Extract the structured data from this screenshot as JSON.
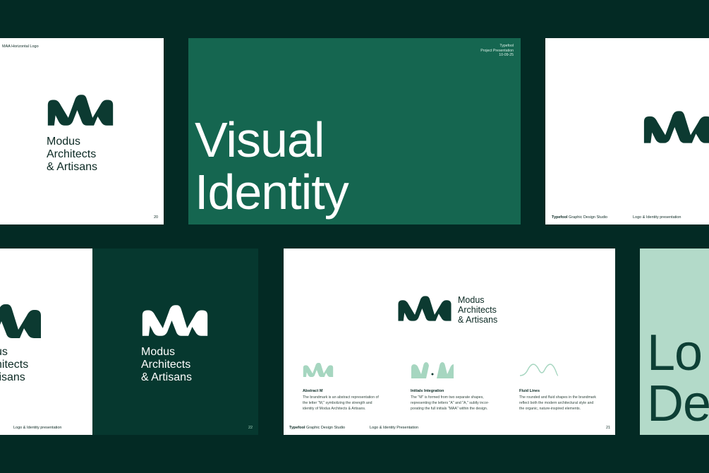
{
  "colors": {
    "background": "#032a24",
    "brand_green": "#156650",
    "dark_green": "#06382f",
    "mint": "#b3dac9",
    "logo_dark": "#0c3a31",
    "logo_light": "#a6d6c0"
  },
  "brand": {
    "logo_icon": "modus-m-logo",
    "name_lines": "Modus\nArchitects\n& Artisans"
  },
  "slide_logo": {
    "label": "MAA Horizontal Logo",
    "page": "20"
  },
  "slide_title": {
    "meta_line1": "Typefool",
    "meta_line2": "Project Presentation",
    "meta_line3": "10-09-25",
    "title_line1": "Visual",
    "title_line2": "Identity"
  },
  "slide_right": {
    "studio_bold": "Typefool",
    "studio_rest": "Graphic Design Studio",
    "section": "Logo & Identity presentation"
  },
  "slide_split_left": {
    "section": "Logo & Identity presentation",
    "name_partial": "us\nhitects\ntisans"
  },
  "slide_dark": {
    "page": "22"
  },
  "slide_concept": {
    "features": [
      {
        "icon": "abstract-m-icon",
        "title": "Abstract M",
        "desc": "The brandmark is an abstract representation of\nthe letter \"M,\" symbolizing the strength and\nidentity of Modus Architects & Artisans."
      },
      {
        "icon": "initials-integration-icon",
        "title": "Initials Integration",
        "desc": "The \"M\" is formed from two separate shapes,\nrepresenting the letters \"A\" and \"A,\" subtly incor-\nporating the full initials \"MAA\" within the design."
      },
      {
        "icon": "fluid-lines-icon",
        "title": "Fluid Lines",
        "desc": "The rounded and fluid shapes in the brandmark\nreflect both the modern architectural style and\nthe organic, nature-inspired elements."
      }
    ],
    "studio_bold": "Typefool",
    "studio_rest": "Graphic Design Studio",
    "section": "Logo & Identity Presentation",
    "page": "21"
  },
  "slide_mint": {
    "word_line1": "Lo",
    "word_line2": "De"
  }
}
